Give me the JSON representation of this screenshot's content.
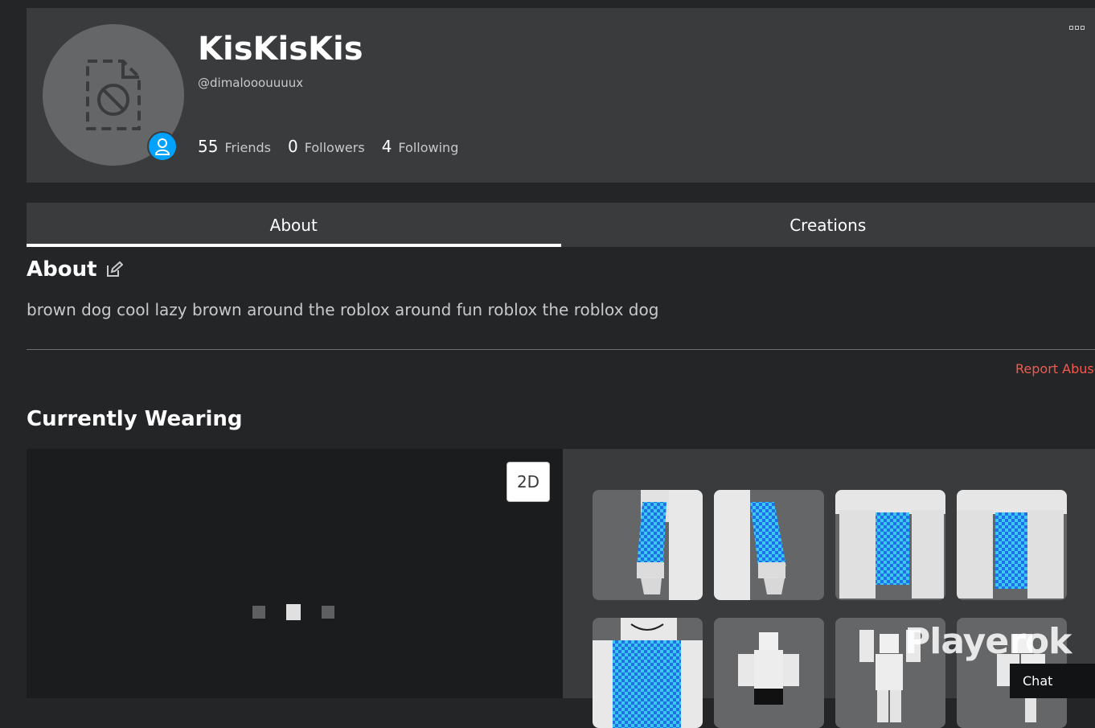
{
  "profile": {
    "display_name": "KisKisKis",
    "username": "@dimalooouuuux",
    "stats": [
      {
        "count": "55",
        "label": "Friends"
      },
      {
        "count": "0",
        "label": "Followers"
      },
      {
        "count": "4",
        "label": "Following"
      }
    ]
  },
  "tabs": [
    {
      "label": "About",
      "active": true
    },
    {
      "label": "Creations",
      "active": false
    }
  ],
  "about": {
    "title": "About",
    "bio": "brown dog cool lazy brown around the roblox around fun roblox the roblox dog",
    "report_label": "Report Abuse"
  },
  "wearing": {
    "title": "Currently Wearing",
    "toggle_label": "2D",
    "items": [
      "item-1",
      "item-2",
      "item-3",
      "item-4",
      "item-5",
      "item-6",
      "item-7",
      "item-8"
    ]
  },
  "watermark": "Playerok",
  "chat_label": "Chat",
  "colors": {
    "accent": "#00a2ff",
    "report": "#f25a4e",
    "checker_a": "#1e6fe8",
    "checker_b": "#3cc8f0"
  }
}
